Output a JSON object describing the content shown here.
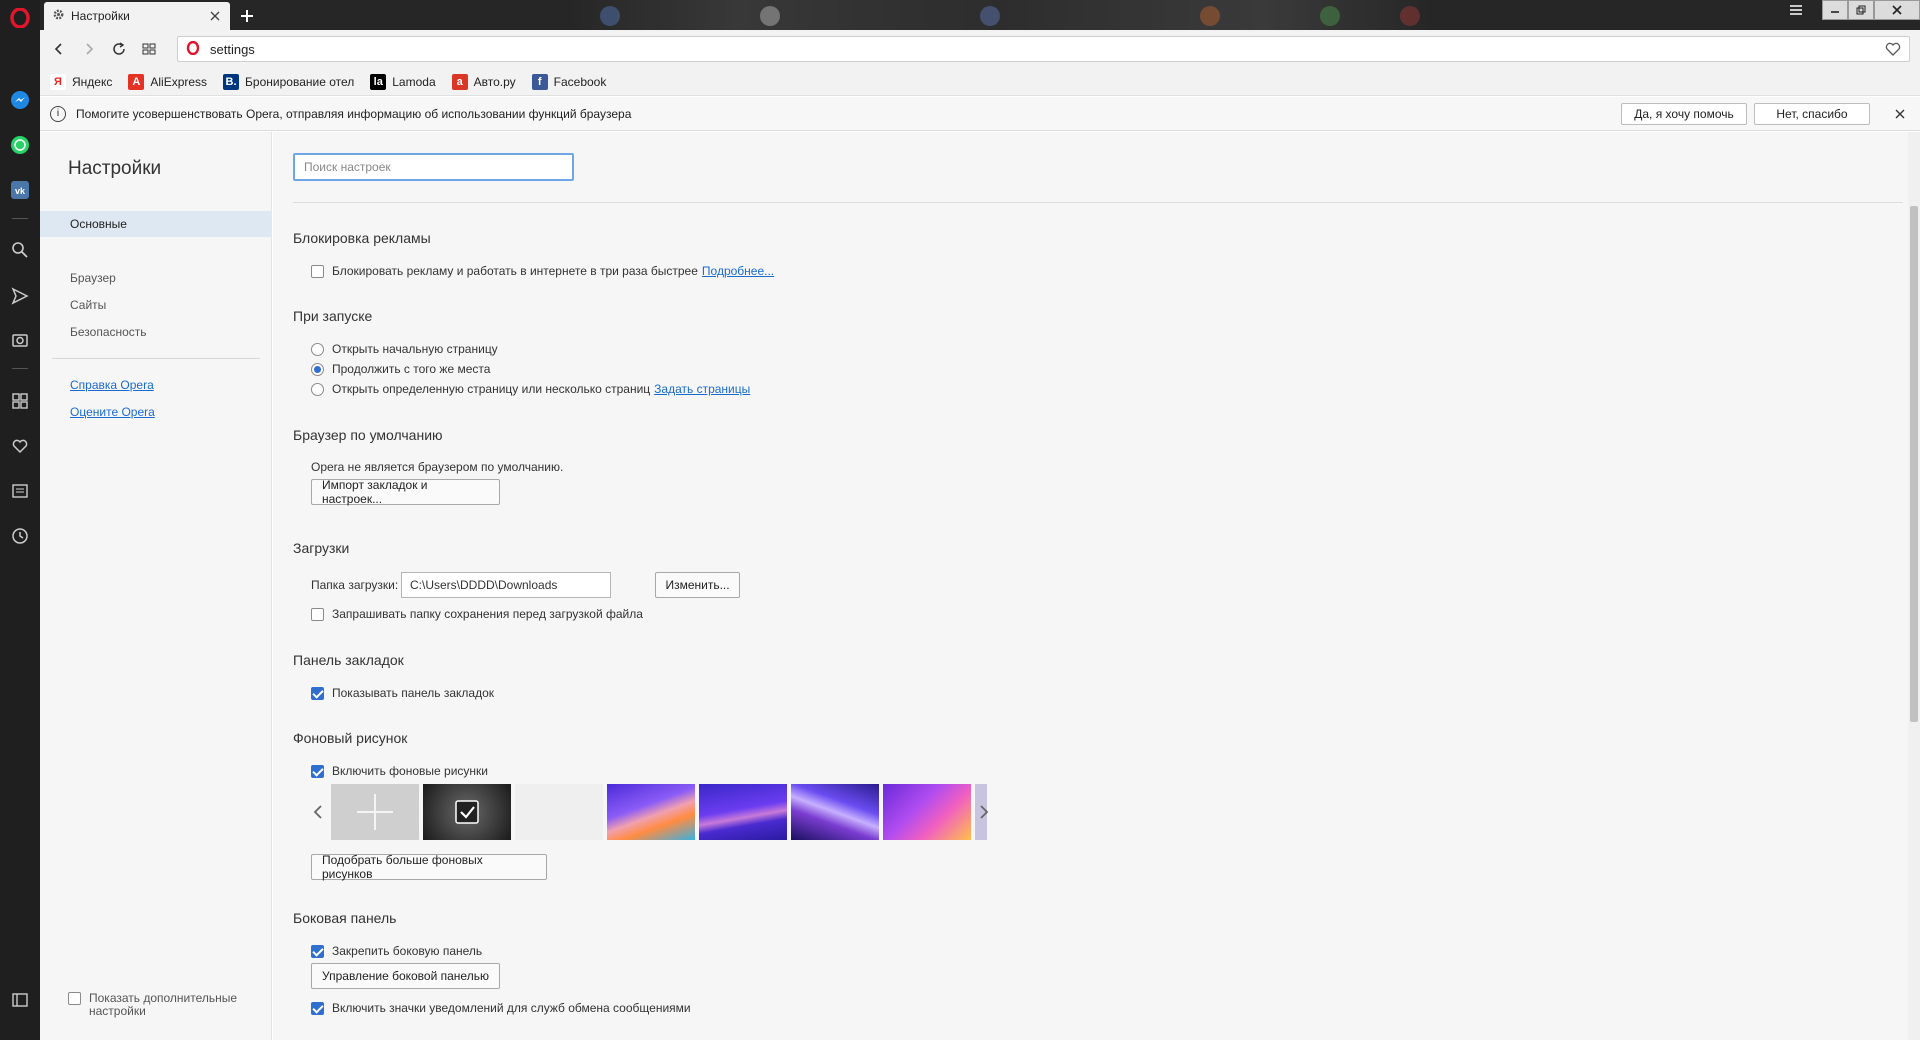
{
  "tab": {
    "title": "Настройки"
  },
  "address": {
    "url": "settings"
  },
  "bookmarks": [
    {
      "label": "Яндекс",
      "icon": "yandex-icon",
      "color": "#ffffff",
      "glyph": "Я",
      "glyph_color": "#e52620"
    },
    {
      "label": "AliExpress",
      "icon": "aliexpress-icon",
      "color": "#e43225",
      "glyph": "A",
      "glyph_color": "#ffffff"
    },
    {
      "label": "Бронирование отел",
      "icon": "booking-icon",
      "color": "#003580",
      "glyph": "B.",
      "glyph_color": "#ffffff"
    },
    {
      "label": "Lamoda",
      "icon": "lamoda-icon",
      "color": "#000000",
      "glyph": "la",
      "glyph_color": "#ffffff"
    },
    {
      "label": "Авто.ру",
      "icon": "autoru-icon",
      "color": "#db3727",
      "glyph": "a",
      "glyph_color": "#ffffff"
    },
    {
      "label": "Facebook",
      "icon": "facebook-icon",
      "color": "#3b5998",
      "glyph": "f",
      "glyph_color": "#ffffff"
    }
  ],
  "infobar": {
    "message": "Помогите усовершенствовать Opera, отправляя информацию об использовании функций браузера",
    "yes_label": "Да, я хочу помочь",
    "no_label": "Нет, спасибо"
  },
  "nav": {
    "title": "Настройки",
    "items": [
      "Основные",
      "Браузер",
      "Сайты",
      "Безопасность"
    ],
    "active": "Основные",
    "links": [
      "Справка Opera",
      "Оцените Opera"
    ],
    "show_more": "Показать дополнительные настройки"
  },
  "search": {
    "placeholder": "Поиск настроек"
  },
  "sections": {
    "adblock": {
      "title": "Блокировка рекламы",
      "checkbox": "Блокировать рекламу и работать в интернете в три раза быстрее",
      "link": "Подробнее..."
    },
    "startup": {
      "title": "При запуске",
      "options": [
        "Открыть начальную страницу",
        "Продолжить с того же места",
        "Открыть определенную страницу или несколько страниц"
      ],
      "selected_index": 1,
      "link": "Задать страницы"
    },
    "default_browser": {
      "title": "Браузер по умолчанию",
      "status": "Opera не является браузером по умолчанию.",
      "import_button": "Импорт закладок и настроек..."
    },
    "downloads": {
      "title": "Загрузки",
      "folder_label": "Папка загрузки:",
      "folder_value": "C:\\Users\\DDDD\\Downloads",
      "change_button": "Изменить...",
      "ask_checkbox": "Запрашивать папку сохранения перед загрузкой файла"
    },
    "bookmarks_bar": {
      "title": "Панель закладок",
      "show_checkbox": "Показывать панель закладок"
    },
    "wallpaper": {
      "title": "Фоновый рисунок",
      "enable_checkbox": "Включить фоновые рисунки",
      "more_button": "Подобрать больше фоновых рисунков"
    },
    "sidebar": {
      "title": "Боковая панель",
      "pin_checkbox": "Закрепить боковую панель",
      "manage_button": "Управление боковой панелью",
      "notify_checkbox": "Включить значки уведомлений для служб обмена сообщениями"
    }
  },
  "colors": {
    "accent": "#2f6fcf",
    "link": "#1a6bd0",
    "opera_red": "#e0162b",
    "sidebar_bg": "#1f1f1f"
  }
}
